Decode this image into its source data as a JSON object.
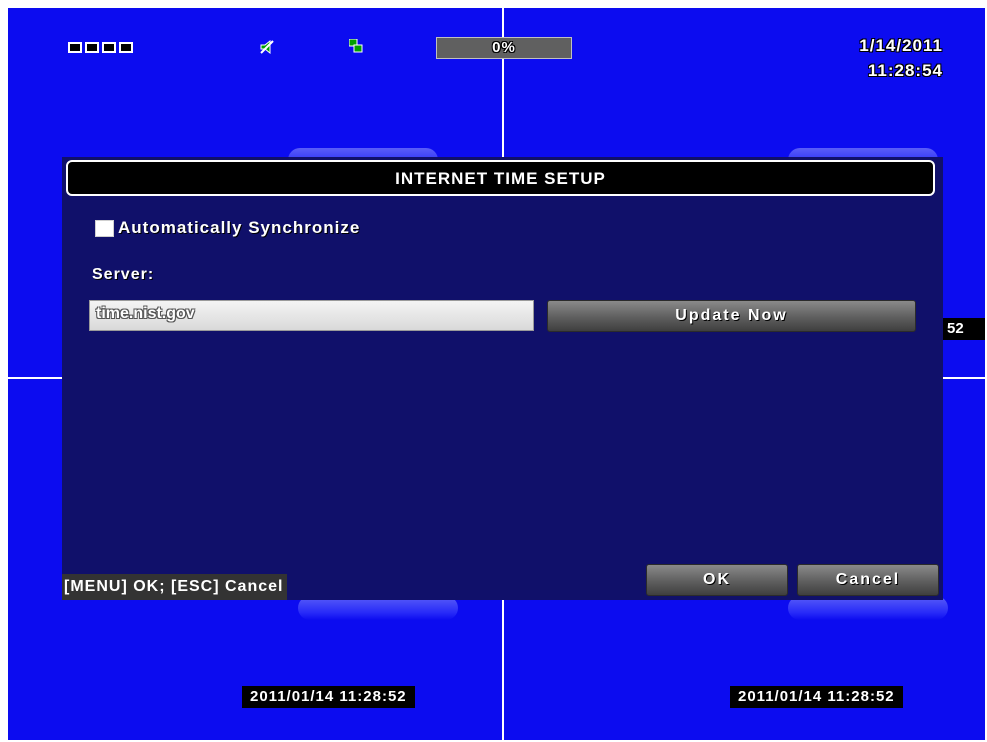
{
  "status_bar": {
    "channel_icons": [
      "channel-1-icon",
      "channel-2-icon",
      "channel-3-icon",
      "channel-4-icon"
    ],
    "audio_icon": "audio-mute-icon",
    "network_icon": "network-icon",
    "progress_text": "0%",
    "progress_value": 0,
    "date": "1/14/2011",
    "time": "11:28:54"
  },
  "camera_stamps": {
    "bottom_left": "2011/01/14 11:28:52",
    "bottom_right": "2011/01/14 11:28:52",
    "right_edge": "52"
  },
  "dialog": {
    "title": "INTERNET TIME SETUP",
    "auto_sync_label": "Automatically Synchronize",
    "auto_sync_checked": false,
    "server_label": "Server:",
    "server_value": "time.nist.gov",
    "update_now_label": "Update Now",
    "hint_text": "[MENU] OK; [ESC] Cancel",
    "ok_label": "OK",
    "cancel_label": "Cancel"
  },
  "colors": {
    "background_blue": "#0000ee",
    "dialog_background": "#10106a",
    "button_gray": "#5e5e5e",
    "progress_fill": "#00c000"
  }
}
